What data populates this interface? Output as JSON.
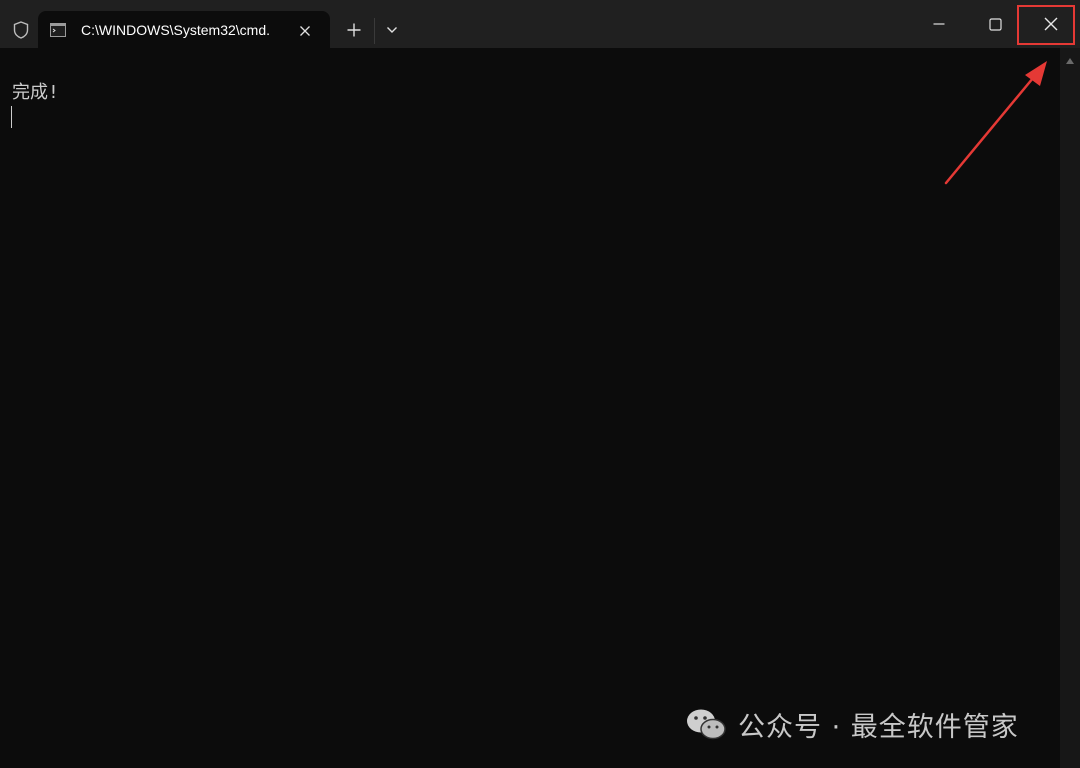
{
  "window": {
    "tab_title": "C:\\WINDOWS\\System32\\cmd.",
    "icons": {
      "shield": "shield-icon",
      "terminal": "terminal-icon",
      "tab_close": "close-icon",
      "new_tab": "plus-icon",
      "dropdown": "chevron-down-icon",
      "minimize": "minimize-icon",
      "maximize": "maximize-icon",
      "close": "close-icon"
    }
  },
  "console": {
    "output_line": "完成!"
  },
  "annotation": {
    "highlight_color": "#e53935"
  },
  "watermark": {
    "text": "公众号 · 最全软件管家"
  },
  "colors": {
    "titlebar": "#202020",
    "console_bg": "#0c0c0c",
    "console_text": "#cccccc"
  }
}
